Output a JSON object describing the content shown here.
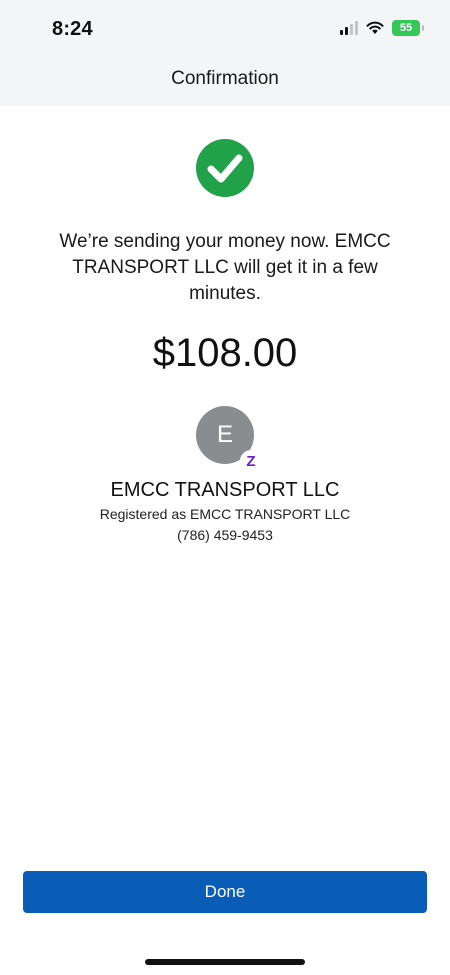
{
  "status_bar": {
    "time": "8:24",
    "battery_level": "55",
    "battery_color": "#35c759"
  },
  "header": {
    "title": "Confirmation"
  },
  "confirmation": {
    "icon": "check-circle-icon",
    "success_color": "#21a24a",
    "message": "We’re sending your money now. EMCC TRANSPORT LLC will get it in a few minutes.",
    "amount": "$108.00"
  },
  "recipient": {
    "avatar_initial": "E",
    "badge_icon": "zelle-icon",
    "badge_color": "#6d1ed4",
    "name": "EMCC TRANSPORT LLC",
    "registered_as": "Registered as EMCC TRANSPORT LLC",
    "phone": "(786) 459-9453"
  },
  "actions": {
    "done_label": "Done",
    "done_color": "#0a5db6"
  }
}
